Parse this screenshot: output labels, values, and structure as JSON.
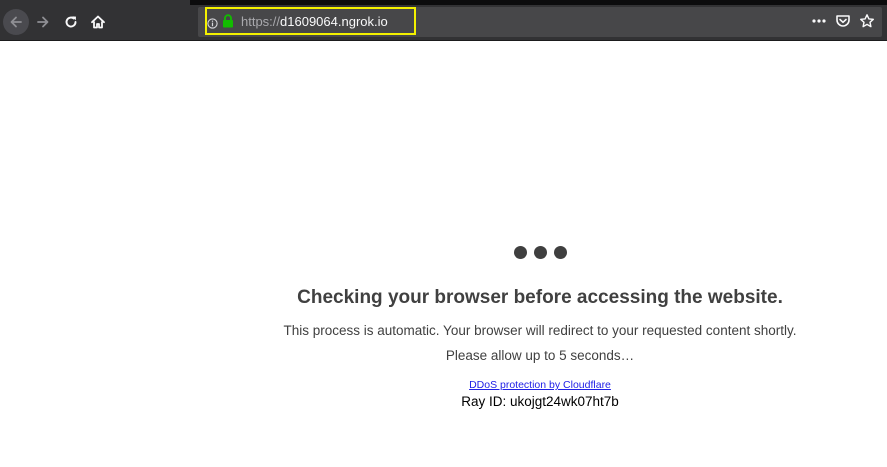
{
  "browser": {
    "url_scheme": "https://",
    "url_host": "d1609064.ngrok.io",
    "icons": {
      "back": "back-arrow-icon",
      "forward": "forward-arrow-icon",
      "reload": "reload-icon",
      "home": "home-icon",
      "info": "info-icon",
      "lock": "lock-icon",
      "more": "more-actions-icon",
      "pocket": "pocket-icon",
      "bookmark": "star-icon"
    },
    "colors": {
      "toolbar": "#323234",
      "urlbar": "#474749",
      "highlight": "#f4f100",
      "lock": "#12bc00"
    }
  },
  "page": {
    "headline": "Checking your browser before accessing the website.",
    "line1": "This process is automatic. Your browser will redirect to your requested content shortly.",
    "line2": "Please allow up to 5 seconds…",
    "link_text": "DDoS protection by Cloudflare",
    "ray_id": "Ray ID: ukojgt24wk07ht7b",
    "colors": {
      "text": "#404040",
      "link": "#2020e6",
      "dots": "#3f3f3f"
    }
  }
}
